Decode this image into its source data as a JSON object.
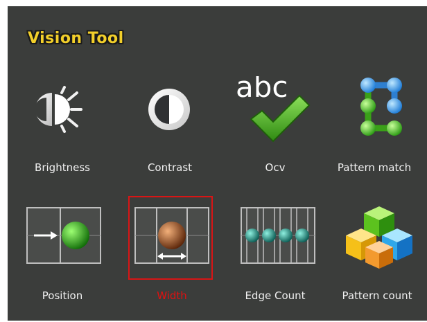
{
  "panel": {
    "title": "Vision Tool"
  },
  "tools": [
    {
      "label": "Brightness",
      "icon": "brightness-icon",
      "selected": false
    },
    {
      "label": "Contrast",
      "icon": "contrast-icon",
      "selected": false
    },
    {
      "label": "Ocv",
      "icon": "ocv-icon",
      "icon_text": "abc",
      "selected": false
    },
    {
      "label": "Pattern match",
      "icon": "pattern-match-icon",
      "selected": false
    },
    {
      "label": "Position",
      "icon": "position-icon",
      "selected": false
    },
    {
      "label": "Width",
      "icon": "width-icon",
      "selected": true
    },
    {
      "label": "Edge Count",
      "icon": "edge-count-icon",
      "selected": false
    },
    {
      "label": "Pattern count",
      "icon": "pattern-count-icon",
      "selected": false
    }
  ],
  "colors": {
    "panel_bg": "#3b3d3b",
    "title": "#f2cf2a",
    "label": "#f0f0f0",
    "selected_label": "#e01010",
    "selection_border": "#d81515"
  }
}
